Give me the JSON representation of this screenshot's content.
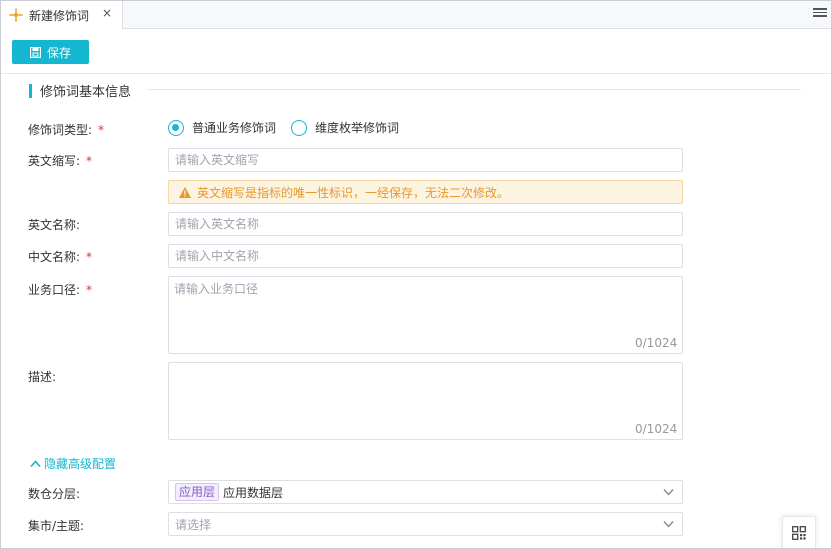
{
  "tab": {
    "title": "新建修饰词",
    "close": "×",
    "logo_icon": "app-logo-icon"
  },
  "toolbar": {
    "save_label": "保存",
    "save_icon": "save-icon"
  },
  "section": {
    "title": "修饰词基本信息"
  },
  "form": {
    "type": {
      "label": "修饰词类型:",
      "required": "*",
      "options": [
        {
          "label": "普通业务修饰词",
          "checked": true
        },
        {
          "label": "维度枚举修饰词",
          "checked": false
        }
      ]
    },
    "abbr": {
      "label": "英文缩写:",
      "required": "*",
      "placeholder": "请输入英文缩写",
      "value": ""
    },
    "abbr_warning": "英文缩写是指标的唯一性标识，一经保存，无法二次修改。",
    "en_name": {
      "label": "英文名称:",
      "placeholder": "请输入英文名称",
      "value": ""
    },
    "cn_name": {
      "label": "中文名称:",
      "required": "*",
      "placeholder": "请输入中文名称",
      "value": ""
    },
    "caliber": {
      "label": "业务口径:",
      "required": "*",
      "placeholder": "请输入业务口径",
      "value": "",
      "counter": "0/1024"
    },
    "desc": {
      "label": "描述:",
      "placeholder": "",
      "value": "",
      "counter": "0/1024"
    },
    "advanced_toggle": "隐藏高级配置",
    "layer": {
      "label": "数仓分层:",
      "tag": "应用层",
      "value": "应用数据层"
    },
    "subject": {
      "label": "集市/主题:",
      "placeholder": "请选择"
    }
  },
  "colors": {
    "accent": "#15b6cf",
    "required": "#e0302d",
    "warning": "#e69a2c",
    "tag": "#8a5bd0"
  }
}
